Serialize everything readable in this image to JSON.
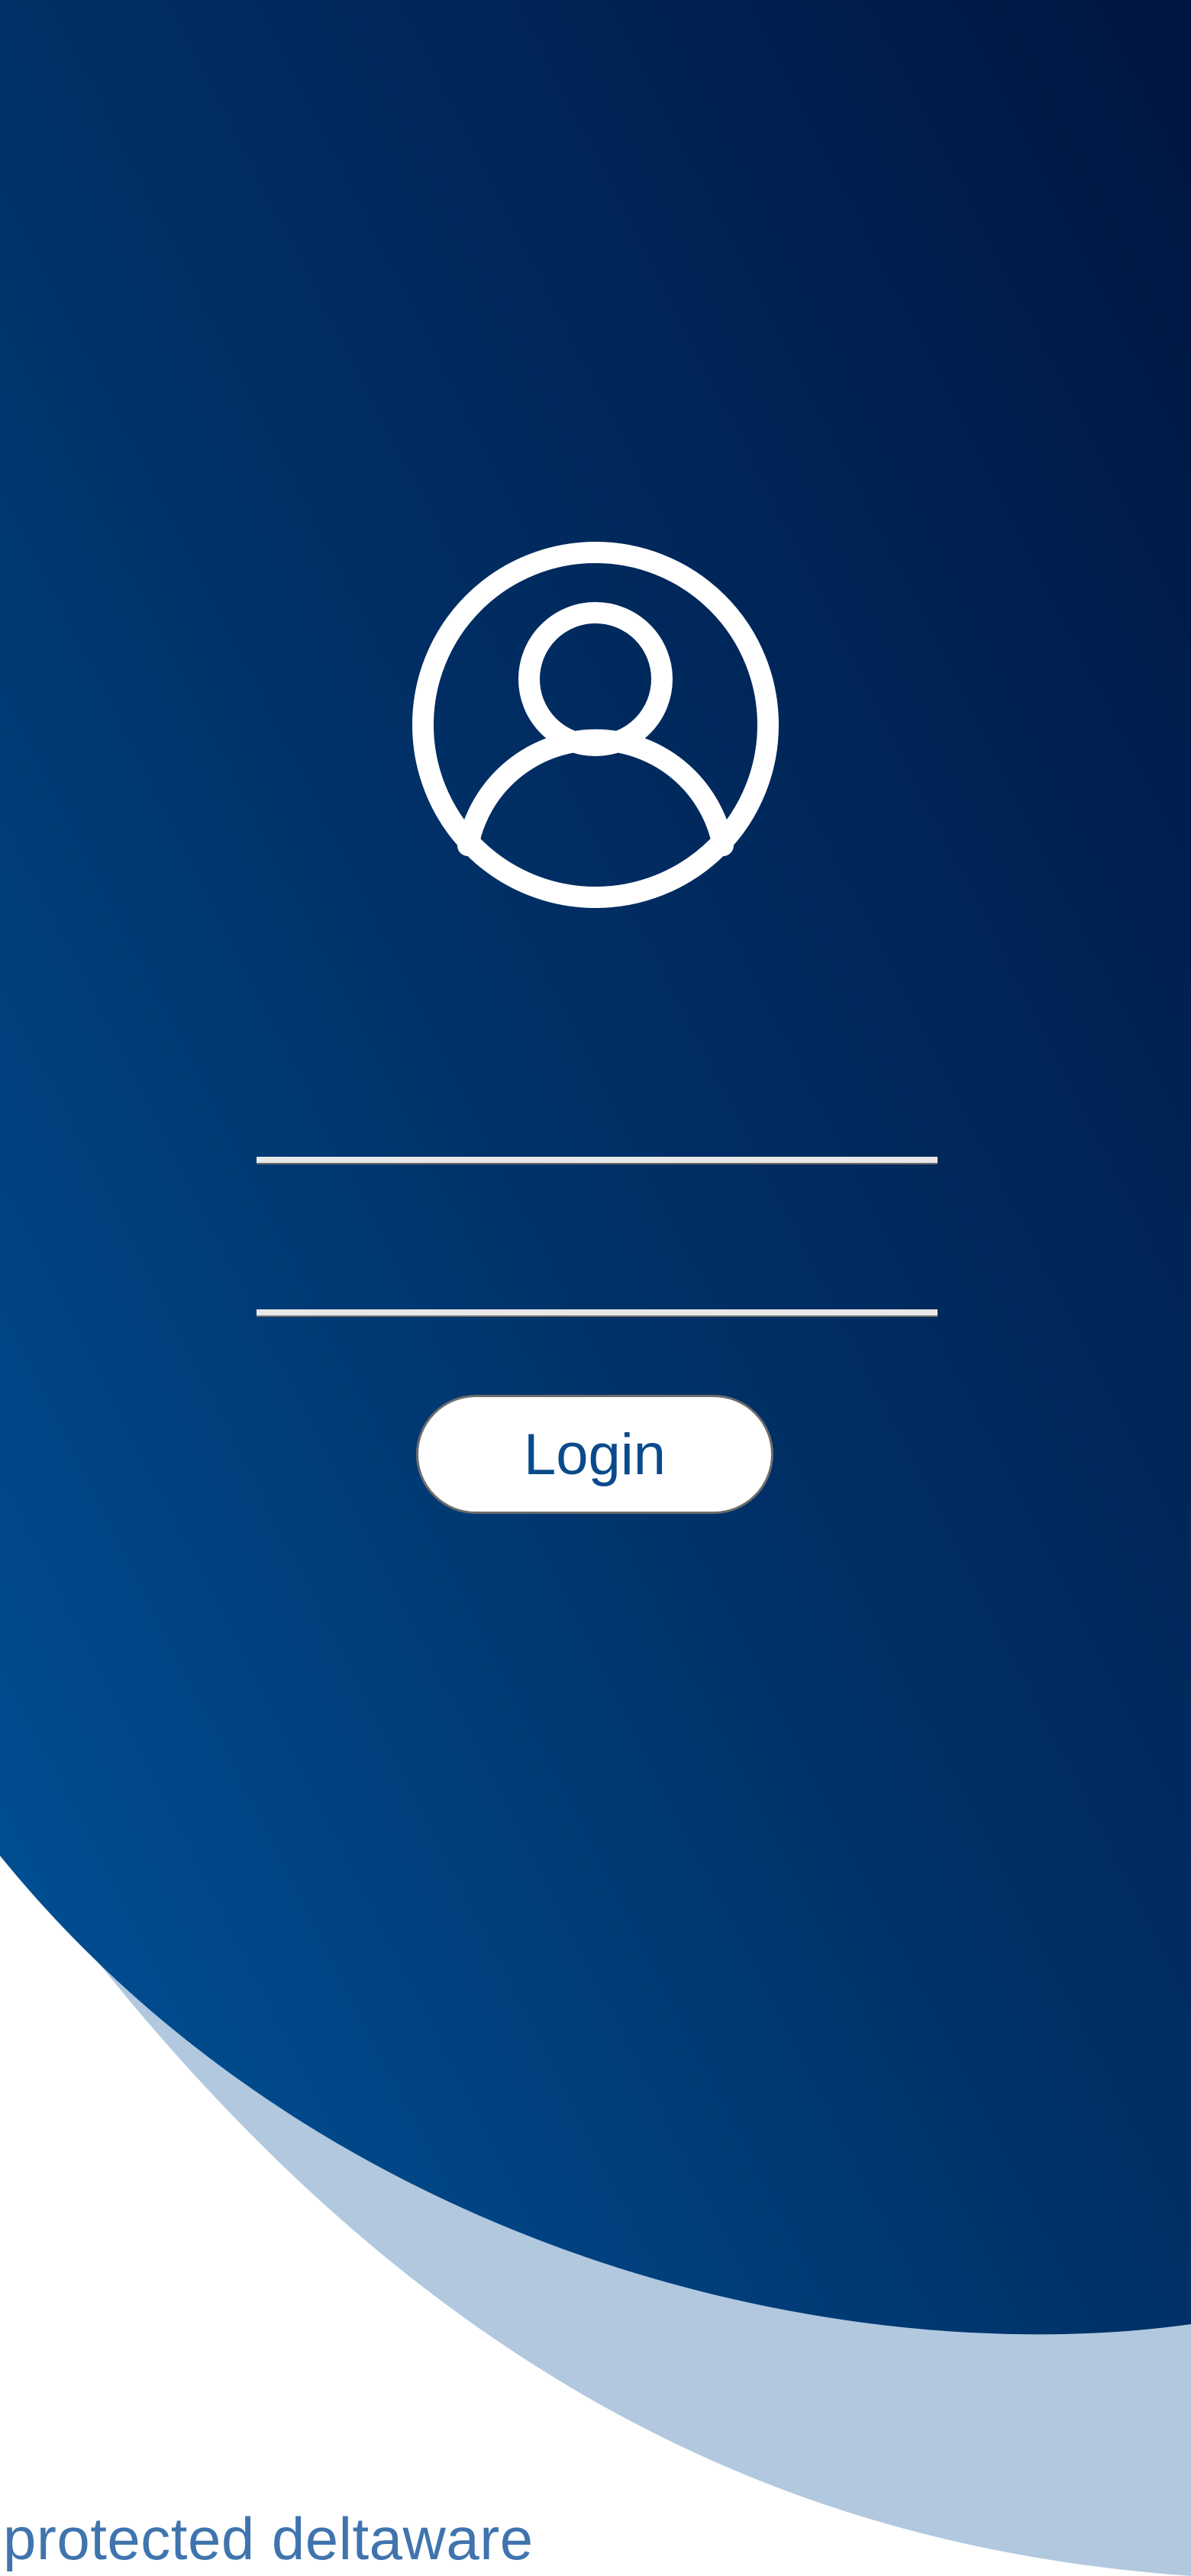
{
  "login_form": {
    "username_value": "",
    "password_value": "",
    "login_label": "Login"
  },
  "footer": {
    "brand_text": "protected deltaware"
  },
  "icons": {
    "avatar": "user-circle-icon"
  },
  "colors": {
    "gradient_dark": "#001540",
    "gradient_light": "#00529a",
    "accent_wave": "#b1c8df",
    "brand_text": "#3f74ae",
    "button_text": "#0a4a8c"
  }
}
